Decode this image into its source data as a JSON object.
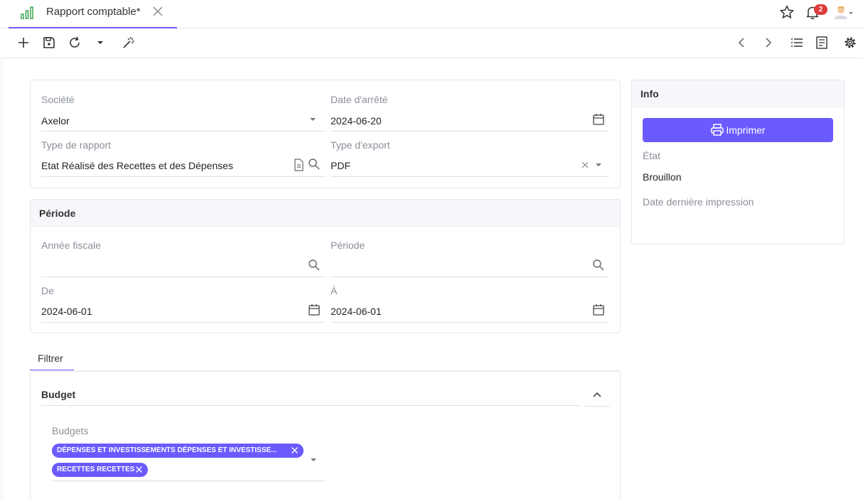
{
  "tab": {
    "title": "Rapport comptable*"
  },
  "notifications": {
    "count": "2"
  },
  "form": {
    "societe": {
      "label": "Société",
      "value": "Axelor"
    },
    "date_arrete": {
      "label": "Date d'arrêté",
      "value": "2024-06-20"
    },
    "type_rapport": {
      "label": "Type de rapport",
      "value": "Etat Réalisé des Recettes et des Dépenses"
    },
    "type_export": {
      "label": "Type d'export",
      "value": "PDF"
    }
  },
  "periode_section": {
    "title": "Période",
    "annee_fiscale": {
      "label": "Année fiscale",
      "value": ""
    },
    "periode": {
      "label": "Période",
      "value": ""
    },
    "de": {
      "label": "De",
      "value": "2024-06-01"
    },
    "a": {
      "label": "À",
      "value": "2024-06-01"
    }
  },
  "info": {
    "title": "Info",
    "print_button": "Imprimer",
    "etat": {
      "label": "État",
      "value": "Brouillon"
    },
    "date_impression": {
      "label": "Date dernière impression",
      "value": ""
    }
  },
  "filter": {
    "tab_label": "Filtrer",
    "budget_title": "Budget",
    "budgets_label": "Budgets",
    "chips": [
      "DÉPENSES ET INVESTISSEMENTS DÉPENSES ET INVESTISSE...",
      "RECETTES RECETTES"
    ]
  },
  "colors": {
    "accent": "#6b5bff",
    "badge": "#e03b3b",
    "app_icon": "#3aa64b"
  }
}
